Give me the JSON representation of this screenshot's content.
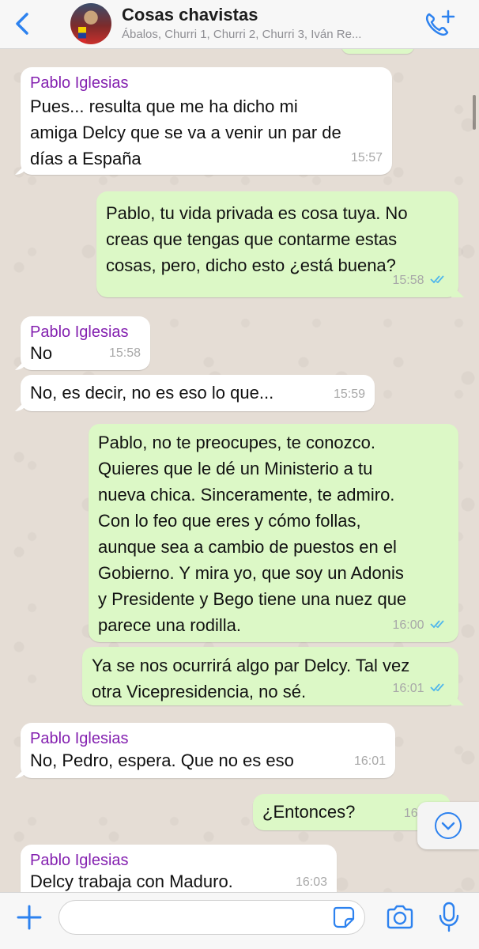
{
  "header": {
    "back_icon": "chevron-left-icon",
    "title": "Cosas chavistas",
    "subtitle": "Ábalos, Churri 1, Churri 2, Churri 3, Iván Re...",
    "call_icon": "phone-plus-icon"
  },
  "messages": [
    {
      "sender": "Pablo Iglesias",
      "text": "Pues... resulta que me ha dicho mi\namiga Delcy que se va a venir un par de\ndías a España",
      "time": "15:57",
      "direction": "in"
    },
    {
      "text": "Pablo, tu vida privada es cosa tuya. No\ncreas que tengas que contarme estas\ncosas, pero, dicho esto ¿está buena?",
      "time": "15:58",
      "direction": "out",
      "status": "read"
    },
    {
      "sender": "Pablo Iglesias",
      "text": "No",
      "time": "15:58",
      "direction": "in"
    },
    {
      "text": "No, es decir, no es eso lo que...",
      "time": "15:59",
      "direction": "in"
    },
    {
      "text": "Pablo, no te preocupes, te conozco.\nQuieres que le dé un Ministerio a tu\nnueva chica. Sinceramente, te admiro.\nCon lo feo que eres y cómo follas,\naunque sea a cambio de puestos en el\nGobierno. Y mira yo, que soy un Adonis\ny Presidente y Bego tiene una nuez que\nparece una rodilla.",
      "time": "16:00",
      "direction": "out",
      "status": "read"
    },
    {
      "text": "Ya se nos ocurrirá algo par Delcy. Tal vez\notra Vicepresidencia, no sé.",
      "time": "16:01",
      "direction": "out",
      "status": "read"
    },
    {
      "sender": "Pablo Iglesias",
      "text": "No, Pedro, espera. Que no es eso",
      "time": "16:01",
      "direction": "in"
    },
    {
      "text": "¿Entonces?",
      "time": "16:0",
      "direction": "out"
    },
    {
      "sender": "Pablo Iglesias",
      "text": "Delcy trabaja con Maduro.",
      "time": "16:03",
      "direction": "in"
    }
  ],
  "scroll_down_icon": "chevron-down-circle-icon",
  "input": {
    "placeholder": "",
    "value": ""
  },
  "bottom_icons": [
    "plus-icon",
    "sticker-icon",
    "camera-icon",
    "microphone-icon"
  ],
  "colors": {
    "accent": "#2d82ef",
    "sender_name": "#8421b0",
    "outgoing_bubble": "#dcf8c6",
    "incoming_bubble": "#ffffff",
    "read_ticks": "#4fb6ec"
  }
}
